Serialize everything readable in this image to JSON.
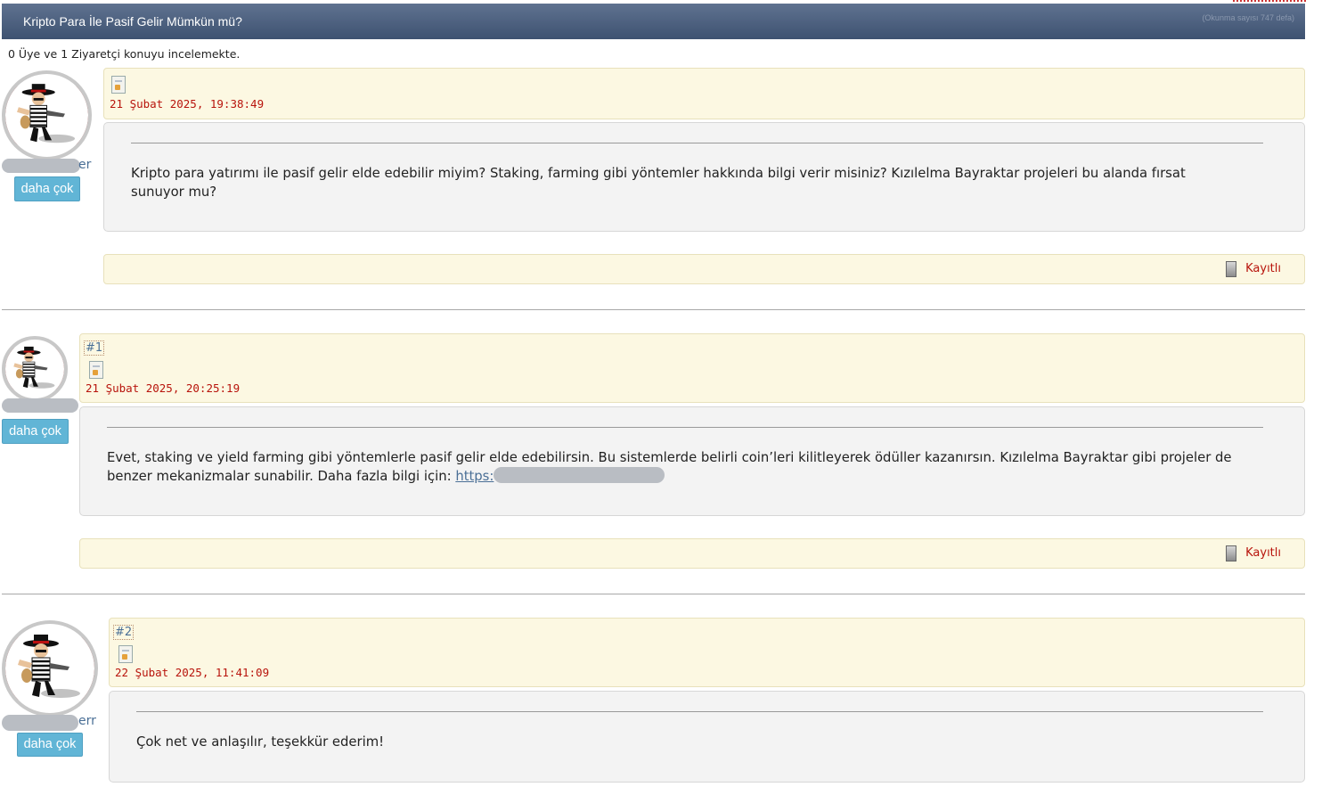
{
  "thread": {
    "title": "Kripto Para İle Pasif Gelir Mümkün mü?",
    "read_count": "(Okunma sayısı 747 defa)",
    "viewers": "0 Üye ve 1 Ziyaretçi konuyu incelemekte."
  },
  "posts": [
    {
      "number": "",
      "date": "21 Şubat 2025, 19:38:49",
      "username_suffix": "er",
      "more_label": "daha çok",
      "text": "Kripto para yatırımı ile pasif gelir elde edebilir miyim? Staking, farming gibi yöntemler hakkında bilgi verir misiniz? Kızılelma Bayraktar projeleri bu alanda fırsat sunuyor mu?",
      "status": "Kayıtlı"
    },
    {
      "number": "#1",
      "date": "21 Şubat 2025, 20:25:19",
      "username_suffix": "",
      "more_label": "daha çok",
      "text": "Evet, staking ve yield farming gibi yöntemlerle pasif gelir elde edebilirsin. Bu sistemlerde belirli coin’leri kilitleyerek ödüller kazanırsın. Kızılelma Bayraktar gibi projeler de benzer mekanizmalar sunabilir. Daha fazla bilgi için: ",
      "link_text": "https:",
      "status": "Kayıtlı"
    },
    {
      "number": "#2",
      "date": "22 Şubat 2025, 11:41:09",
      "username_suffix": "err",
      "more_label": "daha çok",
      "text": "Çok net ve anlaşılır, teşekkür ederim!",
      "status": ""
    }
  ],
  "colors": {
    "title_bar": "#4d6180",
    "date_text": "#b8140c",
    "more_button": "#61b5d6",
    "post_header": "#fcf8e2",
    "post_body": "#f3f3f3"
  },
  "icons": [
    "post-icon",
    "hdd-icon",
    "avatar-figure"
  ]
}
